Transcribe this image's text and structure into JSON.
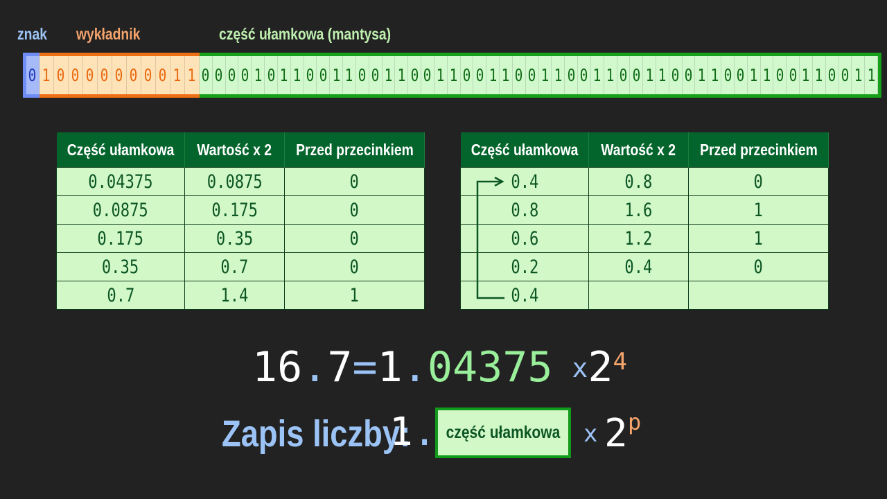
{
  "labels": {
    "sign": "znak",
    "exponent": "wykładnik",
    "mantissa": "część ułamkowa (mantysa)"
  },
  "bits": {
    "sign": "0",
    "exponent": "10000000011",
    "mantissa": "0000101100110011001100110011001100110011001100110011"
  },
  "table_left": {
    "headers": [
      "Część ułamkowa",
      "Wartość x 2",
      "Przed przecinkiem"
    ],
    "rows": [
      [
        "0.04375",
        "0.0875",
        "0"
      ],
      [
        "0.0875",
        "0.175",
        "0"
      ],
      [
        "0.175",
        "0.35",
        "0"
      ],
      [
        "0.35",
        "0.7",
        "0"
      ],
      [
        "0.7",
        "1.4",
        "1"
      ]
    ]
  },
  "table_right": {
    "headers": [
      "Część ułamkowa",
      "Wartość x 2",
      "Przed przecinkiem"
    ],
    "rows": [
      [
        "0.4",
        "0.8",
        "0"
      ],
      [
        "0.8",
        "1.6",
        "1"
      ],
      [
        "0.6",
        "1.2",
        "1"
      ],
      [
        "0.2",
        "0.4",
        "0"
      ],
      [
        "0.4",
        "",
        ""
      ]
    ]
  },
  "equation": {
    "int_part": "16",
    "dot": ".",
    "frac_part": "7",
    "equals": "=",
    "one": "1",
    "dot2": ".",
    "mantissa_digits": "04375",
    "times": "x",
    "base": "2",
    "exponent": "4"
  },
  "notation": {
    "label": "Zapis liczby:",
    "one": "1.",
    "box_text": "część ułamkowa",
    "times": "x",
    "base": "2",
    "exponent_symbol": "p"
  },
  "colors": {
    "background": "#222222",
    "sign": "#6f8df7",
    "exponent": "#ef6f14",
    "mantissa": "#17a11a",
    "table_header": "#03652c",
    "table_cell": "#d3f8c8"
  }
}
